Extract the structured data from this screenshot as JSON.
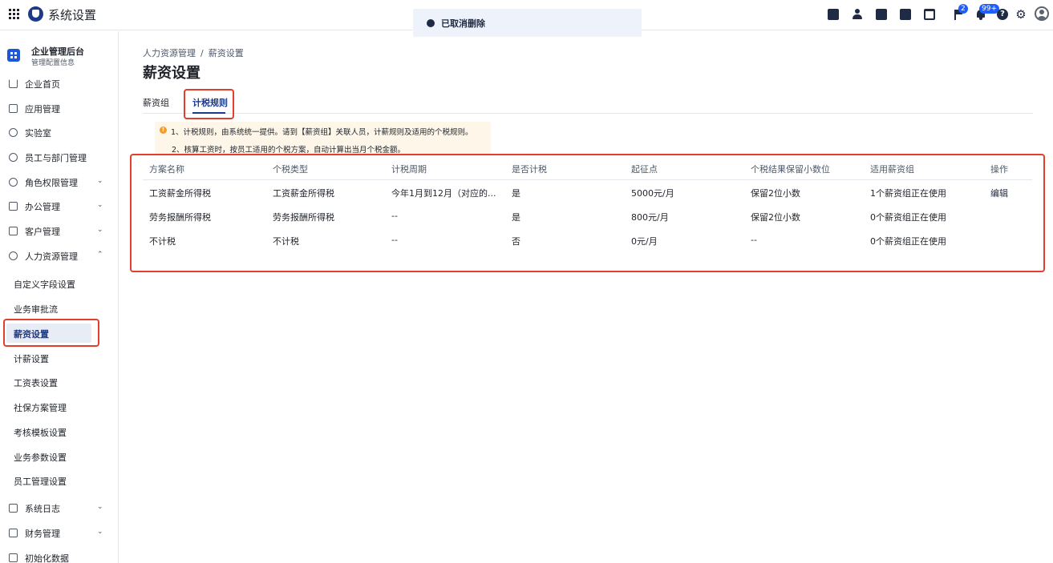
{
  "app": {
    "title": "系统设置"
  },
  "toast": {
    "text": "已取消删除"
  },
  "topbar": {
    "icons": [
      "calendar-check-icon",
      "contacts-icon",
      "document-icon",
      "phone-icon",
      "calendar-icon",
      "flag-icon",
      "bell-icon",
      "help-icon",
      "gear-icon",
      "user-avatar-icon"
    ],
    "flag_badge": "2",
    "bell_badge": "99+"
  },
  "sidebar": {
    "header": {
      "title": "企业管理后台",
      "subtitle": "管理配置信息"
    },
    "items": [
      {
        "label": "企业首页",
        "icon": "home-icon",
        "chevron": ""
      },
      {
        "label": "应用管理",
        "icon": "apps-icon",
        "chevron": ""
      },
      {
        "label": "实验室",
        "icon": "bulb-icon",
        "chevron": ""
      },
      {
        "label": "员工与部门管理",
        "icon": "people-icon",
        "chevron": ""
      },
      {
        "label": "角色权限管理",
        "icon": "role-icon",
        "chevron": "⌄"
      },
      {
        "label": "办公管理",
        "icon": "office-icon",
        "chevron": "⌄"
      },
      {
        "label": "客户管理",
        "icon": "customer-icon",
        "chevron": "⌄"
      },
      {
        "label": "人力资源管理",
        "icon": "hr-icon",
        "chevron": "⌃"
      }
    ],
    "sub_items": [
      {
        "label": "自定义字段设置"
      },
      {
        "label": "业务审批流"
      },
      {
        "label": "薪资设置"
      },
      {
        "label": "计薪设置"
      },
      {
        "label": "工资表设置"
      },
      {
        "label": "社保方案管理"
      },
      {
        "label": "考核模板设置"
      },
      {
        "label": "业务参数设置"
      },
      {
        "label": "员工管理设置"
      }
    ],
    "bottom_items": [
      {
        "label": "系统日志",
        "icon": "log-icon",
        "chevron": "⌄"
      },
      {
        "label": "财务管理",
        "icon": "finance-icon",
        "chevron": "⌄"
      },
      {
        "label": "初始化数据",
        "icon": "init-icon",
        "chevron": ""
      }
    ]
  },
  "breadcrumb": {
    "parent": "人力资源管理",
    "separator": "/",
    "current": "薪资设置"
  },
  "page": {
    "title": "薪资设置"
  },
  "tabs": [
    {
      "label": "薪资组",
      "active": false
    },
    {
      "label": "计税规则",
      "active": true
    }
  ],
  "notice": {
    "icon": "!",
    "line1": "1、计税规则，由系统统一提供。请到【薪资组】关联人员，计薪规则及适用的个税规则。",
    "line2": "2、核算工资时，按员工适用的个税方案，自动计算出当月个税金额。"
  },
  "table": {
    "columns": [
      "方案名称",
      "个税类型",
      "计税周期",
      "是否计税",
      "起征点",
      "个税结果保留小数位",
      "适用薪资组",
      "操作"
    ],
    "rows": [
      [
        "工资薪金所得税",
        "工资薪金所得税",
        "今年1月到12月（对应的...",
        "是",
        "5000元/月",
        "保留2位小数",
        "1个薪资组正在使用",
        "编辑"
      ],
      [
        "劳务报酬所得税",
        "劳务报酬所得税",
        "--",
        "是",
        "800元/月",
        "保留2位小数",
        "0个薪资组正在使用",
        ""
      ],
      [
        "不计税",
        "不计税",
        "--",
        "否",
        "0元/月",
        "--",
        "0个薪资组正在使用",
        ""
      ]
    ]
  },
  "colors": {
    "accent": "#1d3a8a",
    "highlight": "#e0402b",
    "badge": "#1e5eff",
    "notice_bg": "#fdf6e9"
  }
}
